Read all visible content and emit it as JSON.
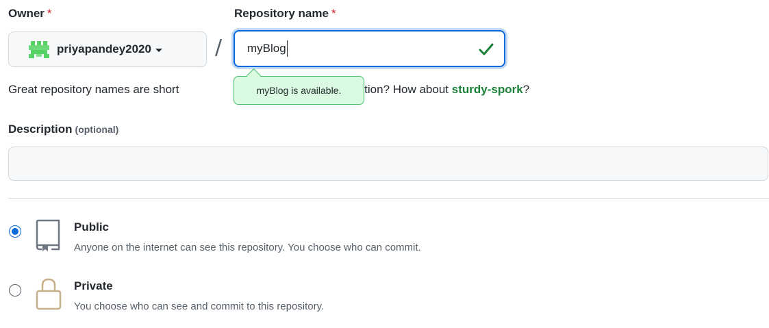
{
  "owner": {
    "label": "Owner",
    "required_mark": "*",
    "selected": "priyapandey2020",
    "avatar_icon": "identicon-avatar"
  },
  "repository": {
    "label": "Repository name",
    "required_mark": "*",
    "value": "myBlog",
    "valid_icon": "check-icon",
    "availability_tooltip": "myBlog is available."
  },
  "separator": "/",
  "helper": {
    "prefix": "Great repository names are short",
    "middle": "ed inspiration? How about",
    "suggestion": "sturdy-spork",
    "suffix": "?"
  },
  "description": {
    "label": "Description",
    "optional_note": "(optional)",
    "value": ""
  },
  "visibility": {
    "selected": "public",
    "options": [
      {
        "id": "public",
        "title": "Public",
        "description": "Anyone on the internet can see this repository. You choose who can commit.",
        "icon": "repo-icon"
      },
      {
        "id": "private",
        "title": "Private",
        "description": "You choose who can see and commit to this repository.",
        "icon": "lock-icon"
      }
    ]
  },
  "colors": {
    "accent": "#0969da",
    "success": "#1a7f37",
    "required": "#cf222e",
    "tooltip_bg": "#dafbe1",
    "avatar": "#56d364",
    "lock": "#c5b089"
  }
}
